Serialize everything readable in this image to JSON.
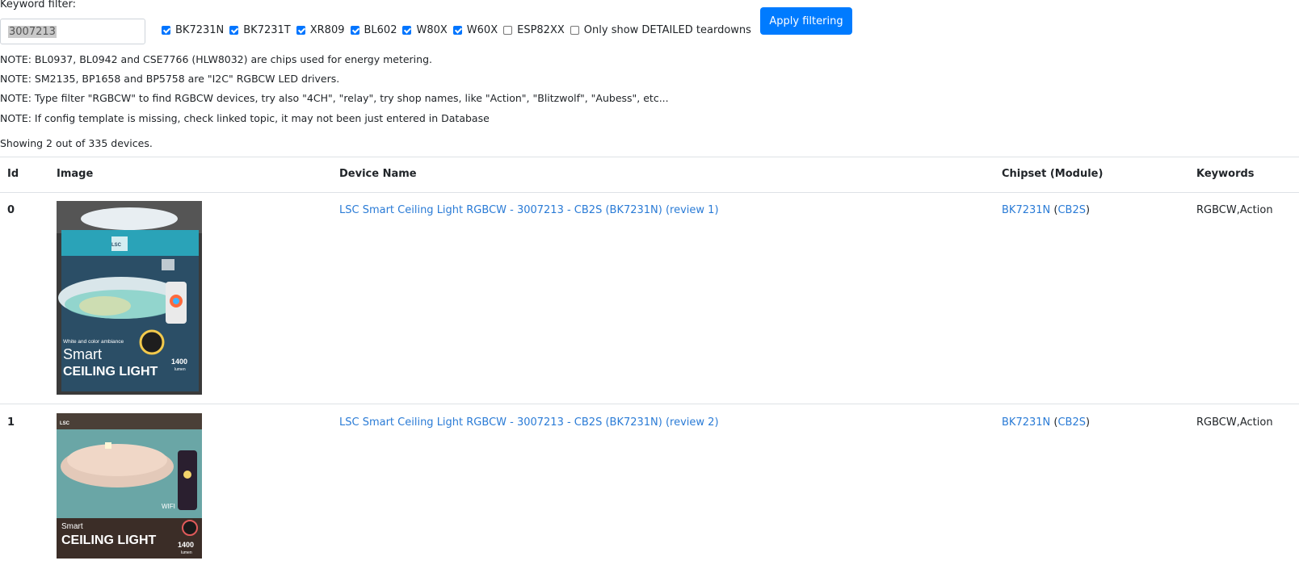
{
  "filter": {
    "label": "Keyword filter:",
    "value": "3007213",
    "apply_label": "Apply filtering"
  },
  "checkboxes": [
    {
      "label": "BK7231N",
      "checked": true
    },
    {
      "label": "BK7231T",
      "checked": true
    },
    {
      "label": "XR809",
      "checked": true
    },
    {
      "label": "BL602",
      "checked": true
    },
    {
      "label": "W80X",
      "checked": true
    },
    {
      "label": "W60X",
      "checked": true
    },
    {
      "label": "ESP82XX",
      "checked": false
    },
    {
      "label": "Only show DETAILED teardowns",
      "checked": false
    }
  ],
  "notes": [
    "NOTE: BL0937, BL0942 and CSE7766 (HLW8032) are chips used for energy metering.",
    "NOTE: SM2135, BP1658 and BP5758 are \"I2C\" RGBCW LED drivers.",
    "NOTE: Type filter \"RGBCW\" to find RGBCW devices, try also \"4CH\", \"relay\", try shop names, like \"Action\", \"Blitzwolf\", \"Aubess\", etc...",
    "NOTE: If config template is missing, check linked topic, it may not been just entered in Database"
  ],
  "showing": "Showing 2 out of 335 devices.",
  "table": {
    "headers": {
      "id": "Id",
      "image": "Image",
      "device_name": "Device Name",
      "chipset": "Chipset (Module)",
      "keywords": "Keywords"
    },
    "rows": [
      {
        "id": "0",
        "device_name": "LSC Smart Ceiling Light RGBCW - 3007213 - CB2S (BK7231N) (review 1)",
        "chip": "BK7231N",
        "module": "CB2S",
        "keywords": "RGBCW,Action",
        "image": {
          "brand": "LSC",
          "tagline": "White and color ambiance",
          "title_small": "Smart",
          "title_big": "CEILING LIGHT",
          "lumens": "1400",
          "lumens_unit": "lumen"
        }
      },
      {
        "id": "1",
        "device_name": "LSC Smart Ceiling Light RGBCW - 3007213 - CB2S (BK7231N) (review 2)",
        "chip": "BK7231N",
        "module": "CB2S",
        "keywords": "RGBCW,Action",
        "image": {
          "brand": "LSC",
          "wifi_label": "WIFI",
          "title_small": "Smart",
          "title_big": "CEILING LIGHT",
          "lumens": "1400",
          "lumens_unit": "lumen"
        }
      }
    ]
  },
  "colors": {
    "link": "#2a7bd6",
    "button": "#007bff",
    "checkbox": "#0075ff"
  }
}
